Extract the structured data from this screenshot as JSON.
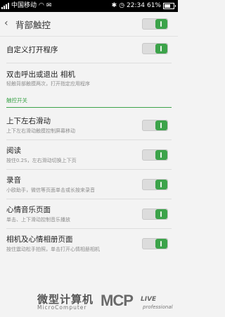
{
  "status_bar": {
    "carrier": "中国移动",
    "time": "22:34",
    "battery": "61%"
  },
  "header": {
    "title": "背部触控",
    "back_icon": "chevron-left-icon",
    "master_toggle": true
  },
  "items_top": [
    {
      "label": "自定义打开程序",
      "toggle": true
    },
    {
      "label": "双击呼出或退出 相机",
      "sub": "轻触背部触摸两次，打开指定应用程序"
    }
  ],
  "section": {
    "title": "触控开关"
  },
  "items": [
    {
      "label": "上下左右滑动",
      "sub": "上下左右滑动触摸控制屏幕移动",
      "toggle": true
    },
    {
      "label": "阅读",
      "sub": "按住0.2S，左右滑动切换上下页",
      "toggle": true
    },
    {
      "label": "录音",
      "sub": "小欧助手，微信等页面单击或长按来录音",
      "toggle": true
    },
    {
      "label": "心情音乐页面",
      "sub": "单击、上下滑动控制音乐播放",
      "toggle": true
    },
    {
      "label": "相机及心情相册页面",
      "sub": "按住震动松手拍照，单击打开心情相册相机",
      "toggle": true
    }
  ],
  "watermark": {
    "cn": "微型计算机",
    "en": "MicroComputer",
    "logo": "MCP",
    "logo2": "LIVE",
    "logo3": "professional"
  },
  "colors": {
    "accent": "#3ca34a",
    "background": "#f3f3f3"
  }
}
